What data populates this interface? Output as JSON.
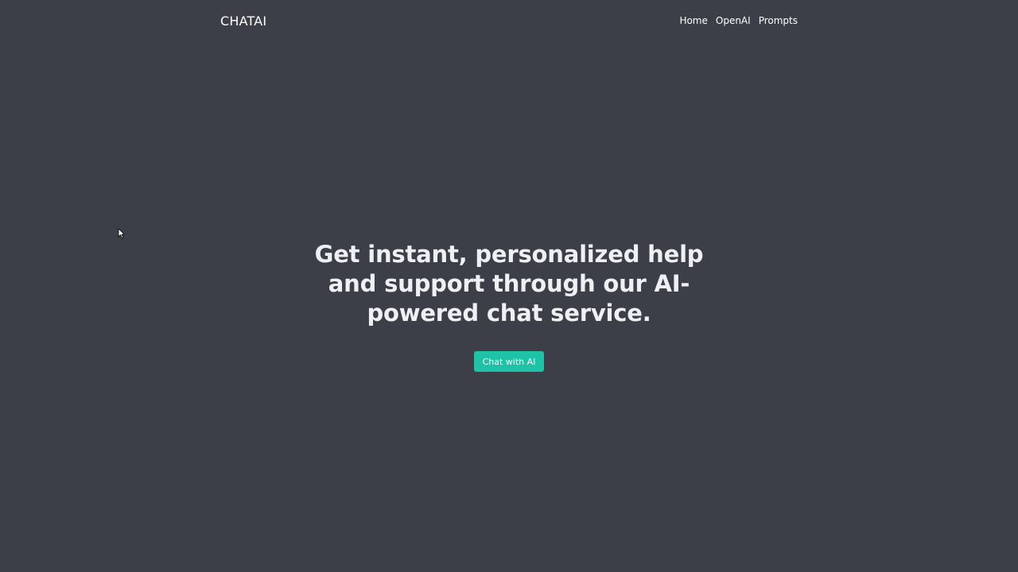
{
  "navbar": {
    "brand": "CHATAI",
    "links": [
      {
        "label": "Home"
      },
      {
        "label": "OpenAI"
      },
      {
        "label": "Prompts"
      }
    ]
  },
  "hero": {
    "title": "Get instant, personalized help and support through our AI-powered chat service.",
    "cta_label": "Chat with AI"
  },
  "colors": {
    "background": "#3c3f47",
    "accent": "#1ec2a6",
    "text": "#ffffff"
  },
  "icons": {
    "cursor": "mouse-pointer-icon"
  }
}
